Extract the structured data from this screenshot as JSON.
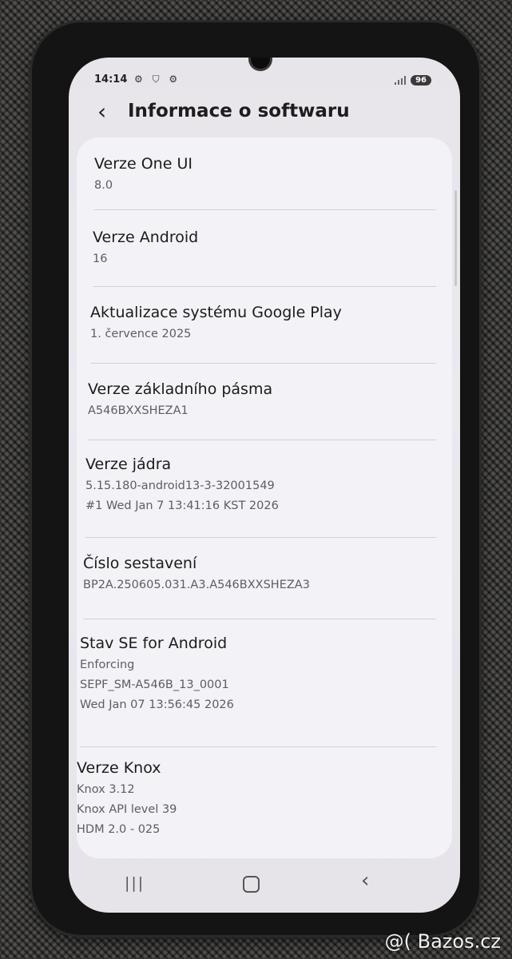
{
  "status_bar": {
    "time": "14:14",
    "icons_left": "⚙ ⛉ ⚙",
    "battery": "96"
  },
  "header": {
    "back_icon": "‹",
    "title": "Informace o softwaru"
  },
  "items": [
    {
      "title": "Verze One UI",
      "lines": [
        "8.0"
      ]
    },
    {
      "title": "Verze Android",
      "lines": [
        "16"
      ]
    },
    {
      "title": "Aktualizace systému Google Play",
      "lines": [
        "1. července 2025"
      ]
    },
    {
      "title": "Verze základního pásma",
      "lines": [
        "A546BXXSHEZA1"
      ]
    },
    {
      "title": "Verze jádra",
      "lines": [
        "5.15.180-android13-3-32001549",
        "#1 Wed Jan 7 13:41:16 KST 2026"
      ]
    },
    {
      "title": "Číslo sestavení",
      "lines": [
        "BP2A.250605.031.A3.A546BXXSHEZA3"
      ]
    },
    {
      "title": "Stav SE for Android",
      "lines": [
        "Enforcing",
        "SEPF_SM-A546B_13_0001",
        "Wed Jan 07 13:56:45 2026"
      ]
    },
    {
      "title": "Verze Knox",
      "lines": [
        "Knox 3.12",
        "Knox API level 39",
        "HDM 2.0 - 025"
      ]
    }
  ],
  "nav": {
    "recents": "|||",
    "back": "‹"
  },
  "watermark": "@( Bazos.cz"
}
